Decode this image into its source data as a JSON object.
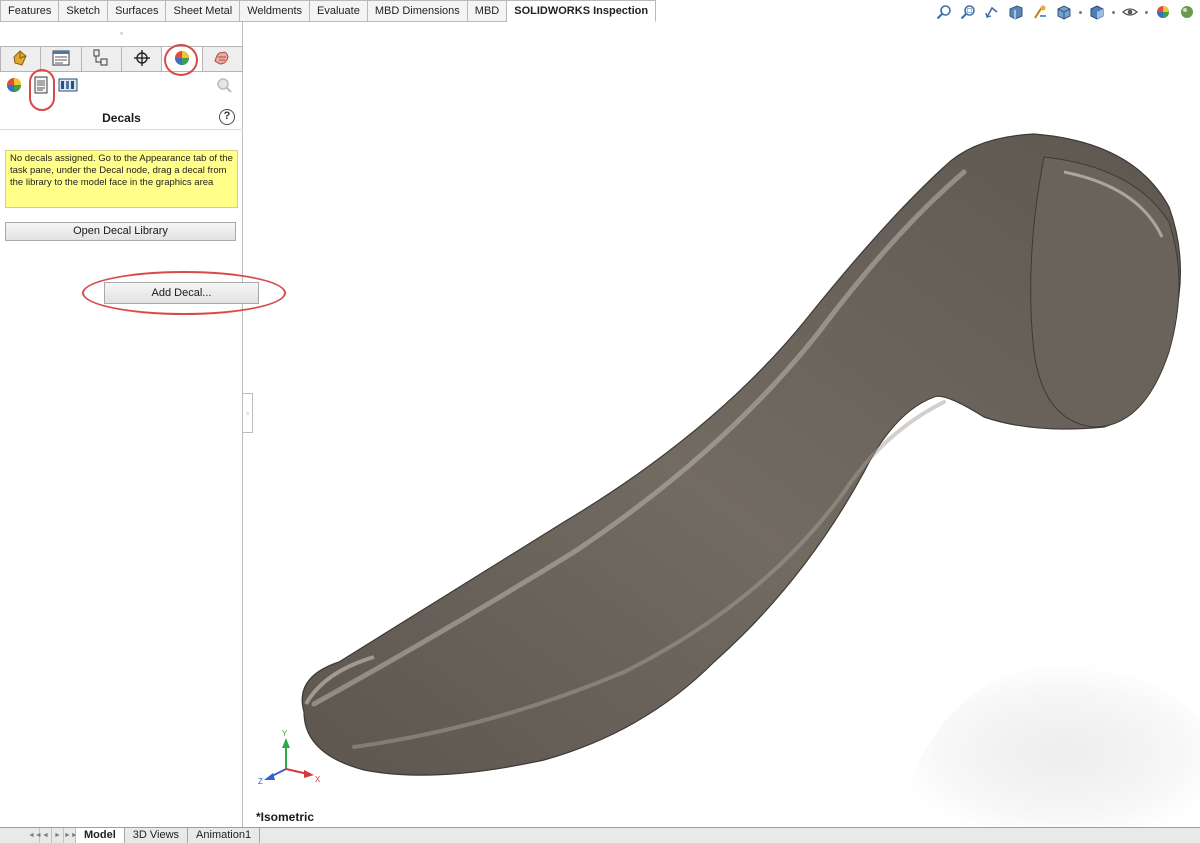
{
  "ribbon": {
    "tabs": [
      {
        "label": "Features"
      },
      {
        "label": "Sketch"
      },
      {
        "label": "Surfaces"
      },
      {
        "label": "Sheet Metal"
      },
      {
        "label": "Weldments"
      },
      {
        "label": "Evaluate"
      },
      {
        "label": "MBD Dimensions"
      },
      {
        "label": "MBD"
      },
      {
        "label": "SOLIDWORKS Inspection"
      }
    ],
    "active_tab": "SOLIDWORKS Inspection"
  },
  "hud_icons": [
    "zoom-to-fit-icon",
    "zoom-to-area-icon",
    "previous-view-icon",
    "section-view-icon",
    "dynamic-annotation-icon",
    "view-orientation-icon",
    "display-style-icon",
    "hide-show-icon",
    "edit-appearance-icon",
    "apply-scene-icon"
  ],
  "panel": {
    "grip": "◦",
    "manager_tabs": [
      "featuremanager-tree-icon",
      "propertymanager-icon",
      "configurationmanager-icon",
      "dimxpert-icon",
      "display-manager-icon",
      "camview-icon"
    ],
    "active_manager_tab": "display-manager-icon",
    "sub_tools": [
      "appearances-icon",
      "decals-icon",
      "scenes-lights-cameras-icon"
    ],
    "active_sub_tool": "decals-icon",
    "title": "Decals",
    "help": "?",
    "note": "No decals assigned. Go to the Appearance tab of the task pane, under the Decal node, drag a decal from the library to the model face in the graphics area",
    "open_library_label": "Open Decal Library",
    "add_decal_label": "Add Decal...",
    "collapse_glyph": "◦"
  },
  "viewport": {
    "view_name": "*Isometric",
    "part_color": "#6b655d",
    "triad": {
      "x": "X",
      "y": "Y",
      "z": "Z"
    }
  },
  "bottom_tabs": {
    "nav": [
      "◄◄",
      "◄",
      "►",
      "►►"
    ],
    "tabs": [
      {
        "label": "Model",
        "active": true
      },
      {
        "label": "3D Views",
        "active": false
      },
      {
        "label": "Animation1",
        "active": false
      }
    ]
  },
  "colors": {
    "highlight_ring": "#d84a4a",
    "note_background": "#ffff8a"
  }
}
